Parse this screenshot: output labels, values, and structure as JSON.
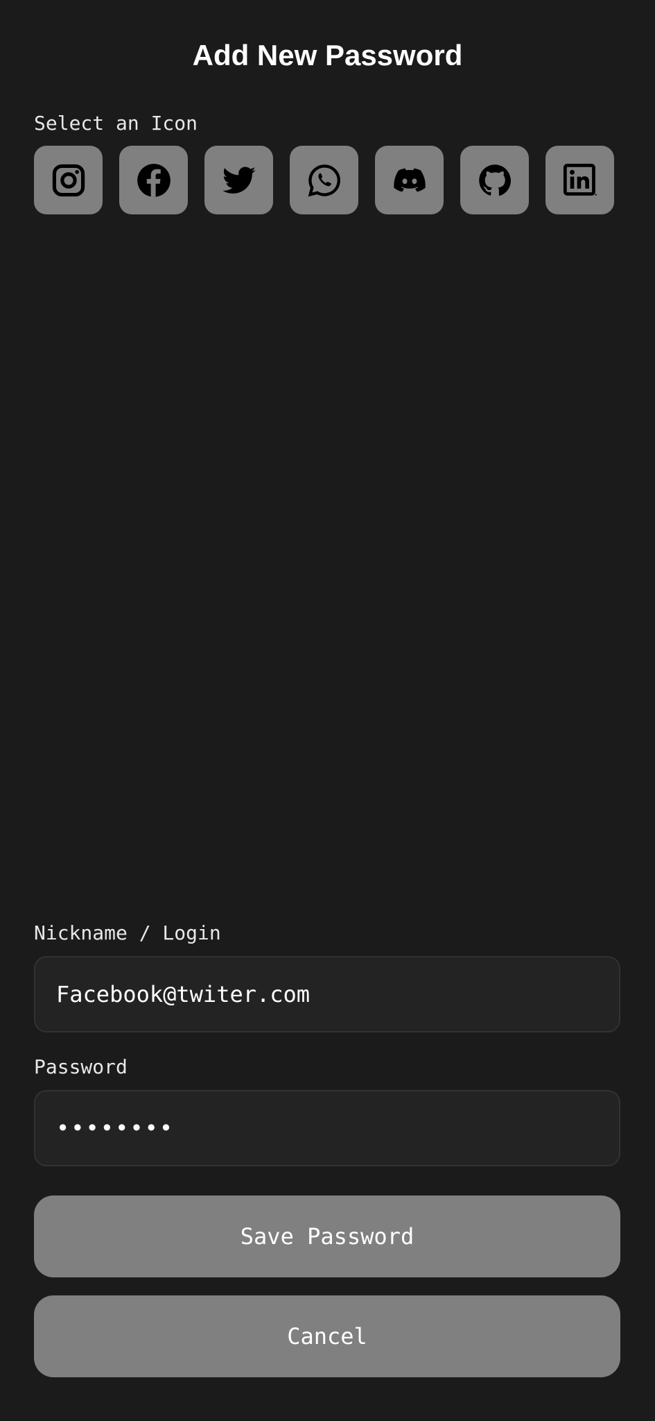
{
  "header": {
    "title": "Add New Password"
  },
  "icon_section": {
    "label": "Select an Icon",
    "icons": [
      {
        "name": "instagram-icon"
      },
      {
        "name": "facebook-icon"
      },
      {
        "name": "twitter-icon"
      },
      {
        "name": "whatsapp-icon"
      },
      {
        "name": "discord-icon"
      },
      {
        "name": "github-icon"
      },
      {
        "name": "linkedin-icon"
      }
    ]
  },
  "form": {
    "nickname_label": "Nickname / Login",
    "nickname_value": "Facebook@twiter.com",
    "password_label": "Password",
    "password_value": "••••••••"
  },
  "actions": {
    "save_label": "Save Password",
    "cancel_label": "Cancel"
  },
  "colors": {
    "background": "#1b1b1b",
    "icon_tile": "#808080",
    "field_background": "#232323",
    "button": "#808080",
    "text": "#ffffff"
  }
}
